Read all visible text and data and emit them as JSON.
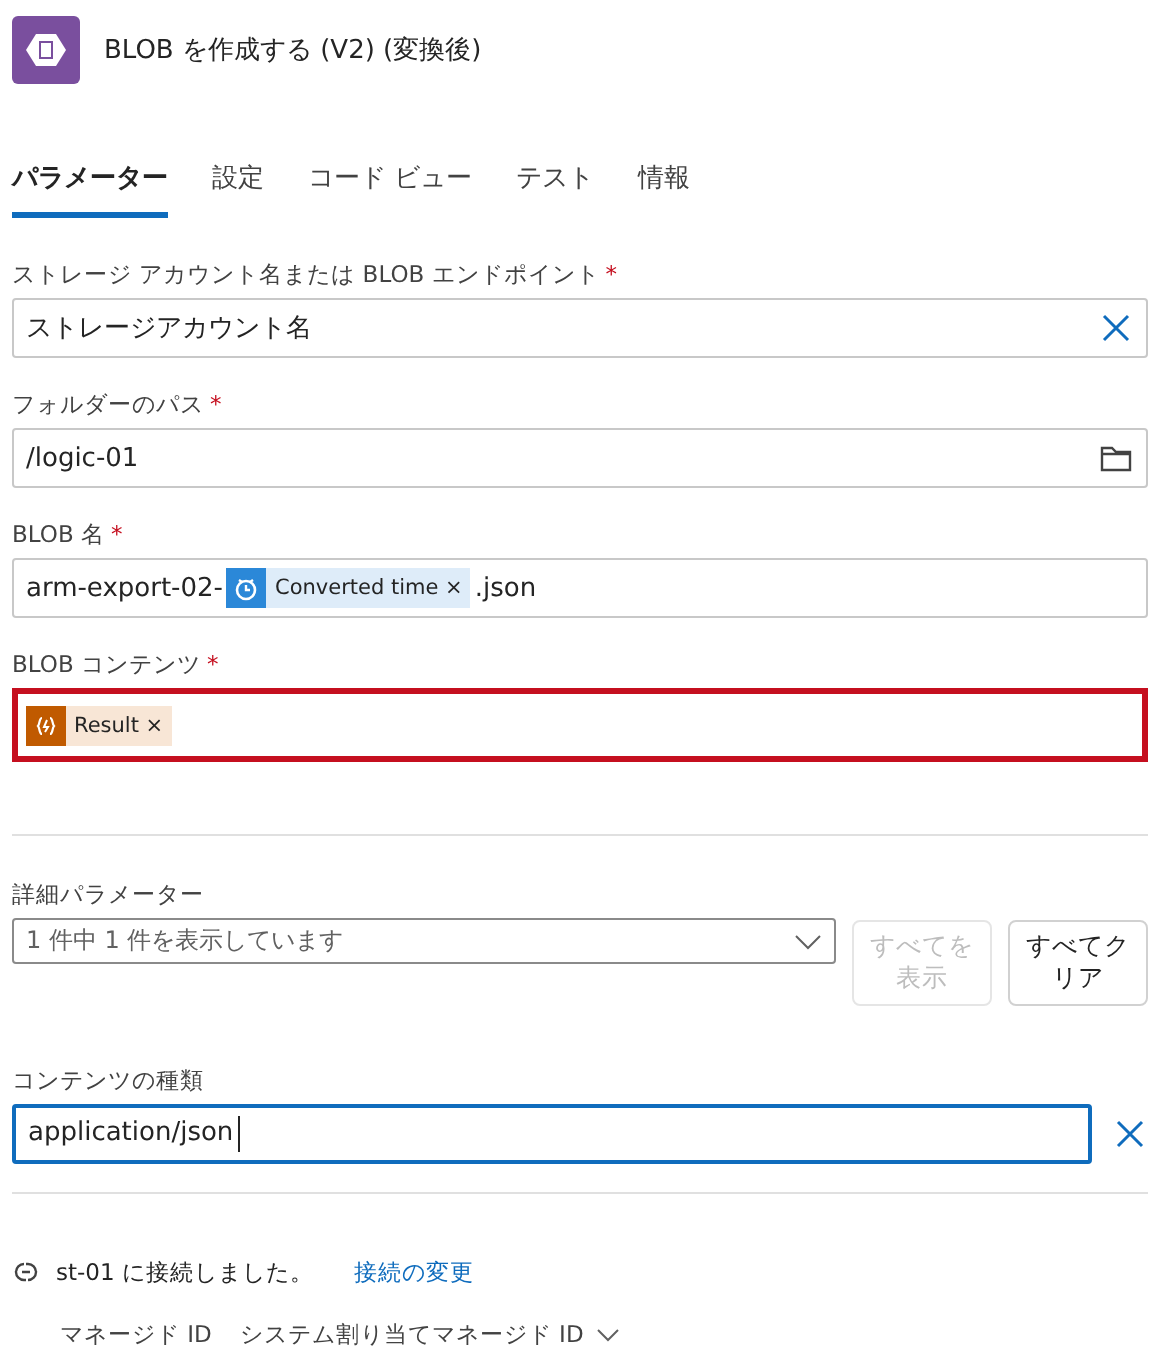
{
  "header": {
    "title": "BLOB を作成する (V2) (変換後)"
  },
  "tabs": [
    {
      "label": "パラメーター",
      "selected": true
    },
    {
      "label": "設定",
      "selected": false
    },
    {
      "label": "コード ビュー",
      "selected": false
    },
    {
      "label": "テスト",
      "selected": false
    },
    {
      "label": "情報",
      "selected": false
    }
  ],
  "fields": [
    {
      "label": "ストレージ アカウント名または BLOB エンドポイント",
      "required": "*",
      "error": false,
      "kind": "clearable",
      "segments": [
        {
          "kind": "text",
          "text": "ストレージアカウント名"
        }
      ]
    },
    {
      "label": "フォルダーのパス",
      "required": "*",
      "error": false,
      "kind": "folder",
      "segments": [
        {
          "kind": "text",
          "text": "/logic-01"
        }
      ]
    },
    {
      "label": "BLOB 名",
      "required": "*",
      "error": false,
      "kind": "tokens",
      "segments": [
        {
          "kind": "text",
          "text": "arm-export-02-"
        },
        {
          "kind": "timestamp",
          "color": "#2b88d8",
          "text": "Converted time",
          "remove": "×"
        },
        {
          "kind": "text",
          "text": ".json"
        }
      ]
    },
    {
      "label": "BLOB コンテンツ",
      "required": "*",
      "error": true,
      "kind": "tokens",
      "segments": [
        {
          "kind": "expression",
          "color": "#c05a00",
          "text": "Result",
          "remove": "×"
        }
      ]
    }
  ],
  "advanced": {
    "label": "詳細パラメーター",
    "dropdown": "1 件中 1 件を表示しています",
    "buttons": [
      {
        "label": "すべてを表示",
        "disabled": true
      },
      {
        "label": "すべてクリア",
        "disabled": false
      }
    ]
  },
  "content_type": {
    "label": "コンテンツの種類",
    "value": "application/json",
    "focused": true
  },
  "connection": {
    "text": "st-01 に接続しました。",
    "link": "接続の変更"
  },
  "managed_id": {
    "label": "マネージド ID",
    "value": "システム割り当てマネージド ID"
  }
}
